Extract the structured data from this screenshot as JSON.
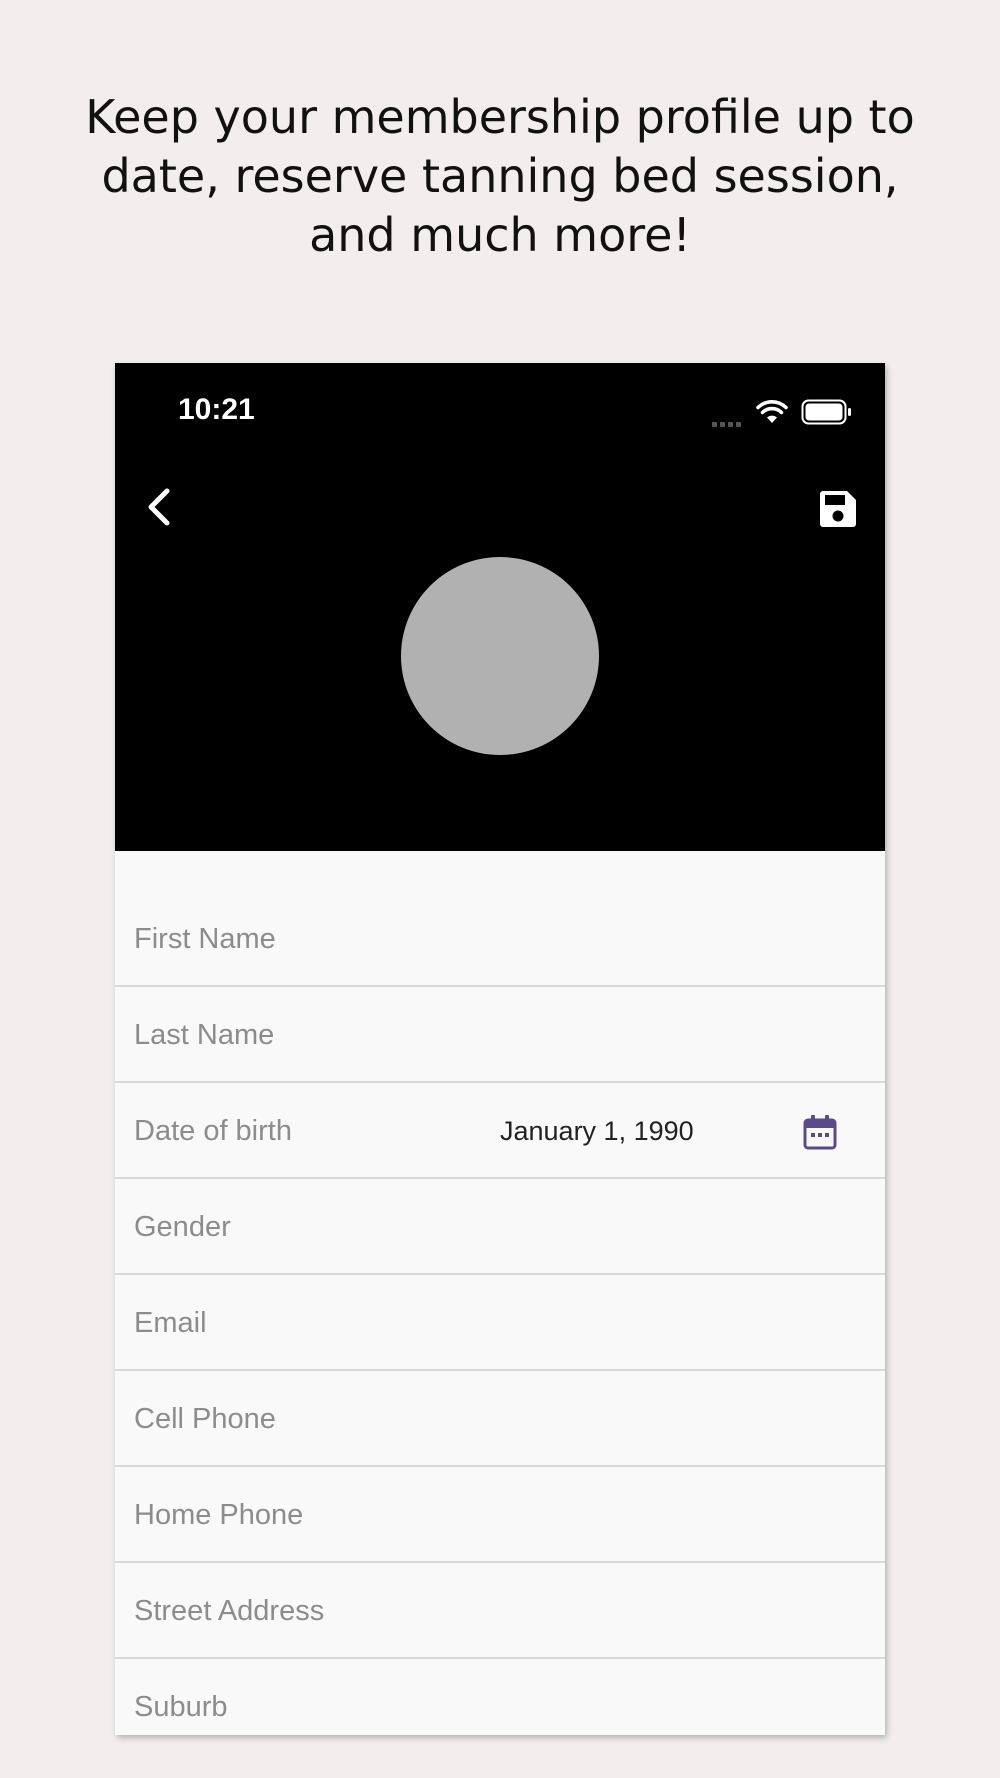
{
  "promo": {
    "headline_line1": "Keep your membership profile up to",
    "headline_line2": "date, reserve tanning bed session,",
    "headline_line3": "and much more!"
  },
  "status_bar": {
    "time": "10:21",
    "icons": [
      "signal-icon",
      "wifi-icon",
      "battery-icon"
    ]
  },
  "header": {
    "back_icon": "chevron-left-icon",
    "save_icon": "floppy-disk-icon",
    "background_color": "#000000",
    "avatar_color": "#b1b1b1"
  },
  "form": {
    "fields": [
      {
        "label": "First Name"
      },
      {
        "label": "Last Name"
      },
      {
        "label": "Date of birth",
        "value": "January 1, 1990",
        "icon": "calendar-icon"
      },
      {
        "label": "Gender"
      },
      {
        "label": "Email"
      },
      {
        "label": "Cell Phone"
      },
      {
        "label": "Home Phone"
      },
      {
        "label": "Street Address"
      },
      {
        "label": "Suburb"
      }
    ],
    "accent_color": "#5b4a8b"
  }
}
